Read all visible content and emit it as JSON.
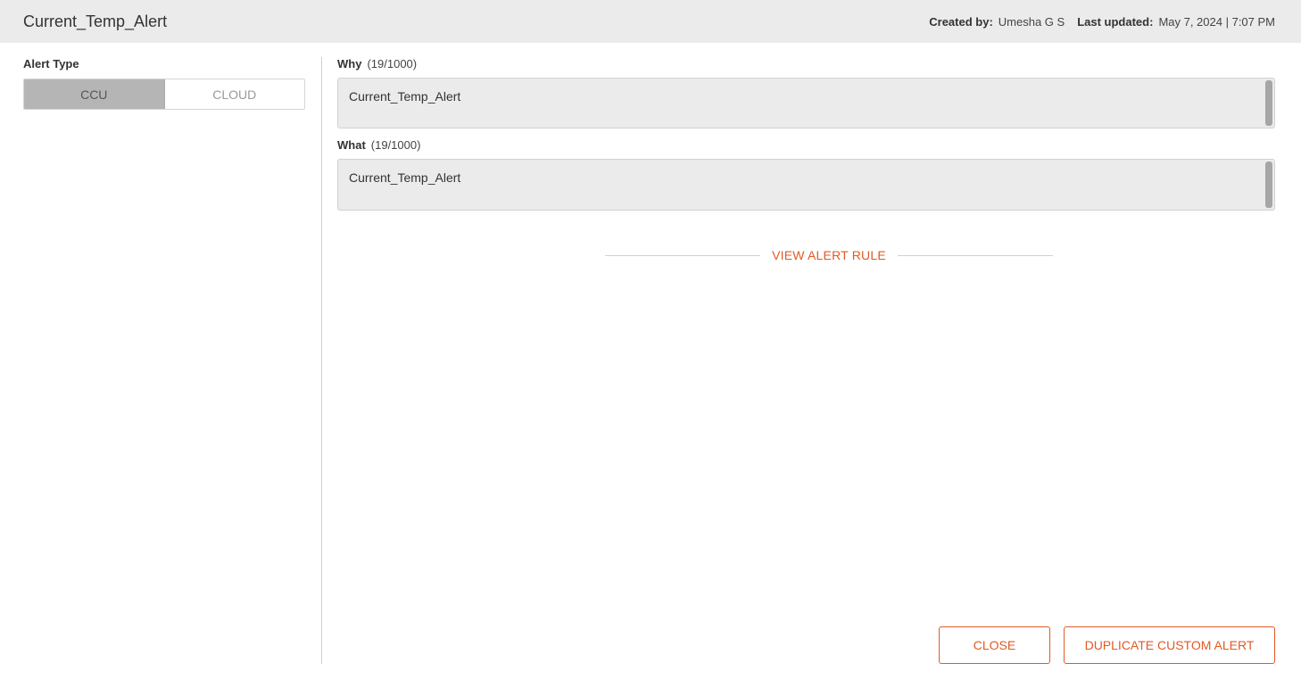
{
  "header": {
    "title": "Current_Temp_Alert",
    "created_by_label": "Created by:",
    "created_by_value": "Umesha G S",
    "last_updated_label": "Last updated:",
    "last_updated_value": "May 7, 2024 | 7:07 PM"
  },
  "alert_type": {
    "label": "Alert Type",
    "options": [
      "CCU",
      "CLOUD"
    ],
    "selected": "CCU"
  },
  "why": {
    "label": "Why",
    "count": "(19/1000)",
    "value": "Current_Temp_Alert"
  },
  "what": {
    "label": "What",
    "count": "(19/1000)",
    "value": "Current_Temp_Alert"
  },
  "view_rule": {
    "label": "VIEW ALERT RULE"
  },
  "buttons": {
    "close": "CLOSE",
    "duplicate": "DUPLICATE CUSTOM ALERT"
  },
  "colors": {
    "accent": "#e05a24",
    "header_bg": "#ebebeb",
    "toggle_active_bg": "#b5b5b5"
  }
}
